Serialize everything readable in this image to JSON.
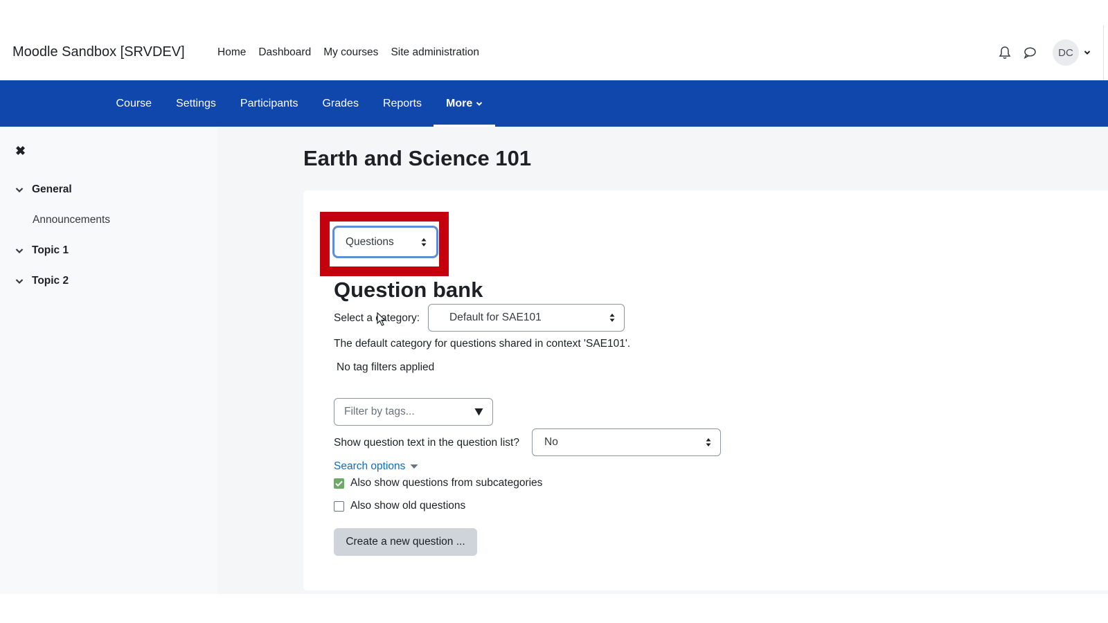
{
  "header": {
    "site_name": "Moodle Sandbox [SRVDEV]",
    "nav": [
      "Home",
      "Dashboard",
      "My courses",
      "Site administration"
    ],
    "avatar_initials": "DC",
    "icons": [
      "bell-icon",
      "chat-icon",
      "chevron-down-icon"
    ]
  },
  "course_nav": {
    "tabs": [
      "Course",
      "Settings",
      "Participants",
      "Grades",
      "Reports"
    ],
    "more_label": "More",
    "active": "More",
    "bar_color": "#0f47ad"
  },
  "drawer": {
    "close_icon": "close-icon",
    "general_label": "General",
    "announcements_label": "Announcements",
    "topic1_label": "Topic 1",
    "topic2_label": "Topic 2"
  },
  "main": {
    "page_title": "Earth and Science 101",
    "questions_select": "Questions",
    "question_bank_title": "Question bank",
    "category_label": "Select a category:",
    "category_value": "Default for SAE101",
    "category_description": "The default category for questions shared in context 'SAE101'.",
    "tag_filter_status": "No tag filters applied",
    "tag_filter_placeholder": "Filter by tags...",
    "show_text_label": "Show question text in the question list?",
    "show_text_value": "No",
    "search_options_label": "Search options",
    "subcategories_label": "Also show questions from subcategories",
    "subcategories_checked": true,
    "old_questions_label": "Also show old questions",
    "old_questions_checked": false,
    "create_button_label": "Create a new question ...",
    "highlight_color": "#c4000f"
  }
}
